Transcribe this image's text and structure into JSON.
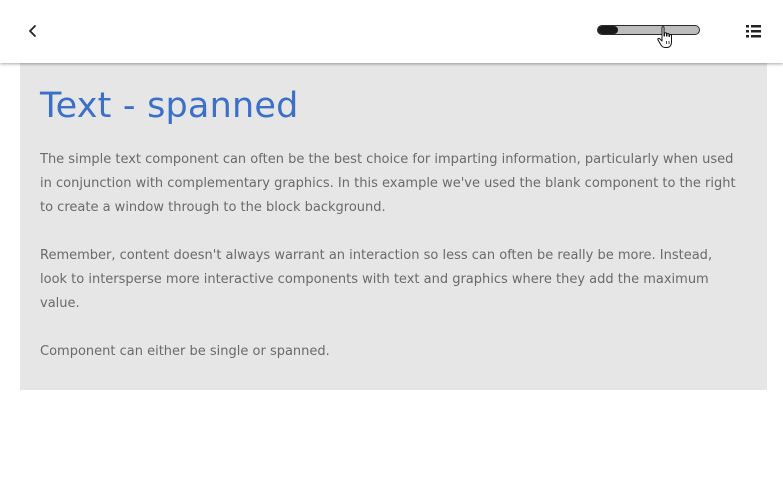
{
  "header": {
    "back_icon": "chevron-left-icon",
    "menu_icon": "list-icon",
    "progress_percent": 20,
    "cursor_icon": "hand-pointer-icon"
  },
  "block": {
    "title": "Text - spanned",
    "paragraphs": [
      "The simple text component can often be the best choice for imparting information, particularly when used in conjunction with complementary graphics. In this example we've used the blank component to the right to create a window through to the block background.",
      "Remember, content doesn't always warrant an interaction so less can often be really be more. Instead, look to intersperse more interactive components with text and graphics where they add the maximum value.",
      "Component can either be single or spanned."
    ]
  },
  "colors": {
    "title": "#3c70c8",
    "body_text": "#6a6a6a",
    "block_background": "#e6e6e6"
  }
}
